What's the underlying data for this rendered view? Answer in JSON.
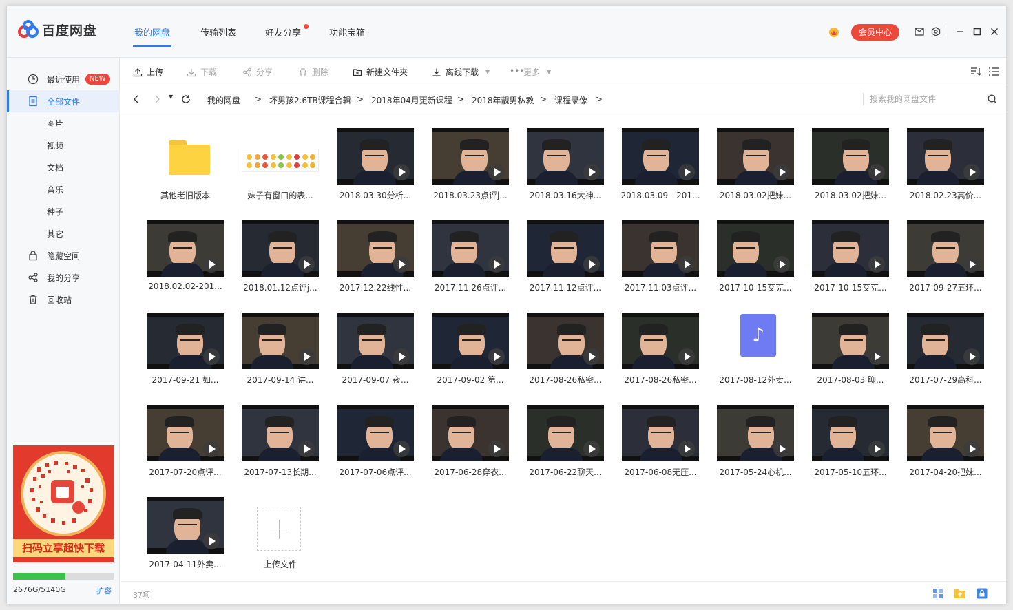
{
  "app": {
    "name": "百度网盘"
  },
  "nav": {
    "tabs": [
      "我的网盘",
      "传输列表",
      "好友分享",
      "功能宝箱"
    ],
    "member_label": "会员中心"
  },
  "sidebar": {
    "items": [
      {
        "label": "最近使用",
        "badge": "NEW",
        "icon": "clock-icon"
      },
      {
        "label": "全部文件",
        "icon": "file-icon",
        "active": true
      },
      {
        "label": "图片"
      },
      {
        "label": "视频"
      },
      {
        "label": "文档"
      },
      {
        "label": "音乐"
      },
      {
        "label": "种子"
      },
      {
        "label": "其它"
      },
      {
        "label": "隐藏空间",
        "icon": "lock-icon"
      },
      {
        "label": "我的分享",
        "icon": "share-icon"
      },
      {
        "label": "回收站",
        "icon": "trash-icon"
      }
    ],
    "promo_text": "扫码立享超快下载",
    "storage": {
      "text": "2676G/5140G",
      "used_fraction": 0.52,
      "expand_label": "扩容"
    }
  },
  "toolbar": {
    "upload": "上传",
    "download": "下载",
    "share": "分享",
    "delete": "删除",
    "new_folder": "新建文件夹",
    "offline": "离线下载",
    "more": "更多"
  },
  "path": {
    "crumbs": [
      "我的网盘",
      "坏男孩2.6TB课程合辑",
      "2018年04月更新课程",
      "2018年靓男私教",
      "课程录像"
    ],
    "separator": ">",
    "search_placeholder": "搜索我的网盘文件"
  },
  "files": [
    {
      "name": "其他老旧版本",
      "type": "folder"
    },
    {
      "name": "妹子有窗口的表...",
      "type": "image"
    },
    {
      "name": "2018.03.30分析...",
      "type": "video"
    },
    {
      "name": "2018.03.23点评j...",
      "type": "video"
    },
    {
      "name": "2018.03.16大神...",
      "type": "video"
    },
    {
      "name": "2018.03.09　201...",
      "type": "video"
    },
    {
      "name": "2018.03.02把妹...",
      "type": "video"
    },
    {
      "name": "2018.03.02把妹...",
      "type": "video"
    },
    {
      "name": "2018.02.23高价...",
      "type": "video"
    },
    {
      "name": "2018.02.02-201...",
      "type": "video"
    },
    {
      "name": "2018.01.12点评j...",
      "type": "video"
    },
    {
      "name": "2017.12.22线性...",
      "type": "video"
    },
    {
      "name": "2017.11.26点评...",
      "type": "video"
    },
    {
      "name": "2017.11.12点评...",
      "type": "video"
    },
    {
      "name": "2017.11.03点评...",
      "type": "video"
    },
    {
      "name": "2017-10-15艾克...",
      "type": "video"
    },
    {
      "name": "2017-10-15艾克...",
      "type": "video"
    },
    {
      "name": "2017-09-27五环...",
      "type": "video"
    },
    {
      "name": "2017-09-21 如...",
      "type": "video"
    },
    {
      "name": "2017-09-14 讲...",
      "type": "video"
    },
    {
      "name": "2017-09-07 夜...",
      "type": "video"
    },
    {
      "name": "2017-09-02 第...",
      "type": "video"
    },
    {
      "name": "2017-08-26私密...",
      "type": "video"
    },
    {
      "name": "2017-08-26私密...",
      "type": "video"
    },
    {
      "name": "2017-08-12外卖...",
      "type": "audio"
    },
    {
      "name": "2017-08-03 聊...",
      "type": "video"
    },
    {
      "name": "2017-07-29高科...",
      "type": "video"
    },
    {
      "name": "2017-07-20点评...",
      "type": "video"
    },
    {
      "name": "2017-07-13长期...",
      "type": "video"
    },
    {
      "name": "2017-07-06点评...",
      "type": "video"
    },
    {
      "name": "2017-06-28穿衣...",
      "type": "video"
    },
    {
      "name": "2017-06-22聊天...",
      "type": "video"
    },
    {
      "name": "2017-06-08无压...",
      "type": "video"
    },
    {
      "name": "2017-05-24心机...",
      "type": "video"
    },
    {
      "name": "2017-05-10五环...",
      "type": "video"
    },
    {
      "name": "2017-04-20把妹...",
      "type": "video"
    },
    {
      "name": "2017-04-11外卖...",
      "type": "video"
    },
    {
      "name": "上传文件",
      "type": "upload"
    }
  ],
  "status": {
    "count": "37项"
  },
  "colors": {
    "accent": "#2e7bf0",
    "member": "#ea4a3c",
    "folder": "#fdd342",
    "audio": "#6f7bf3"
  }
}
